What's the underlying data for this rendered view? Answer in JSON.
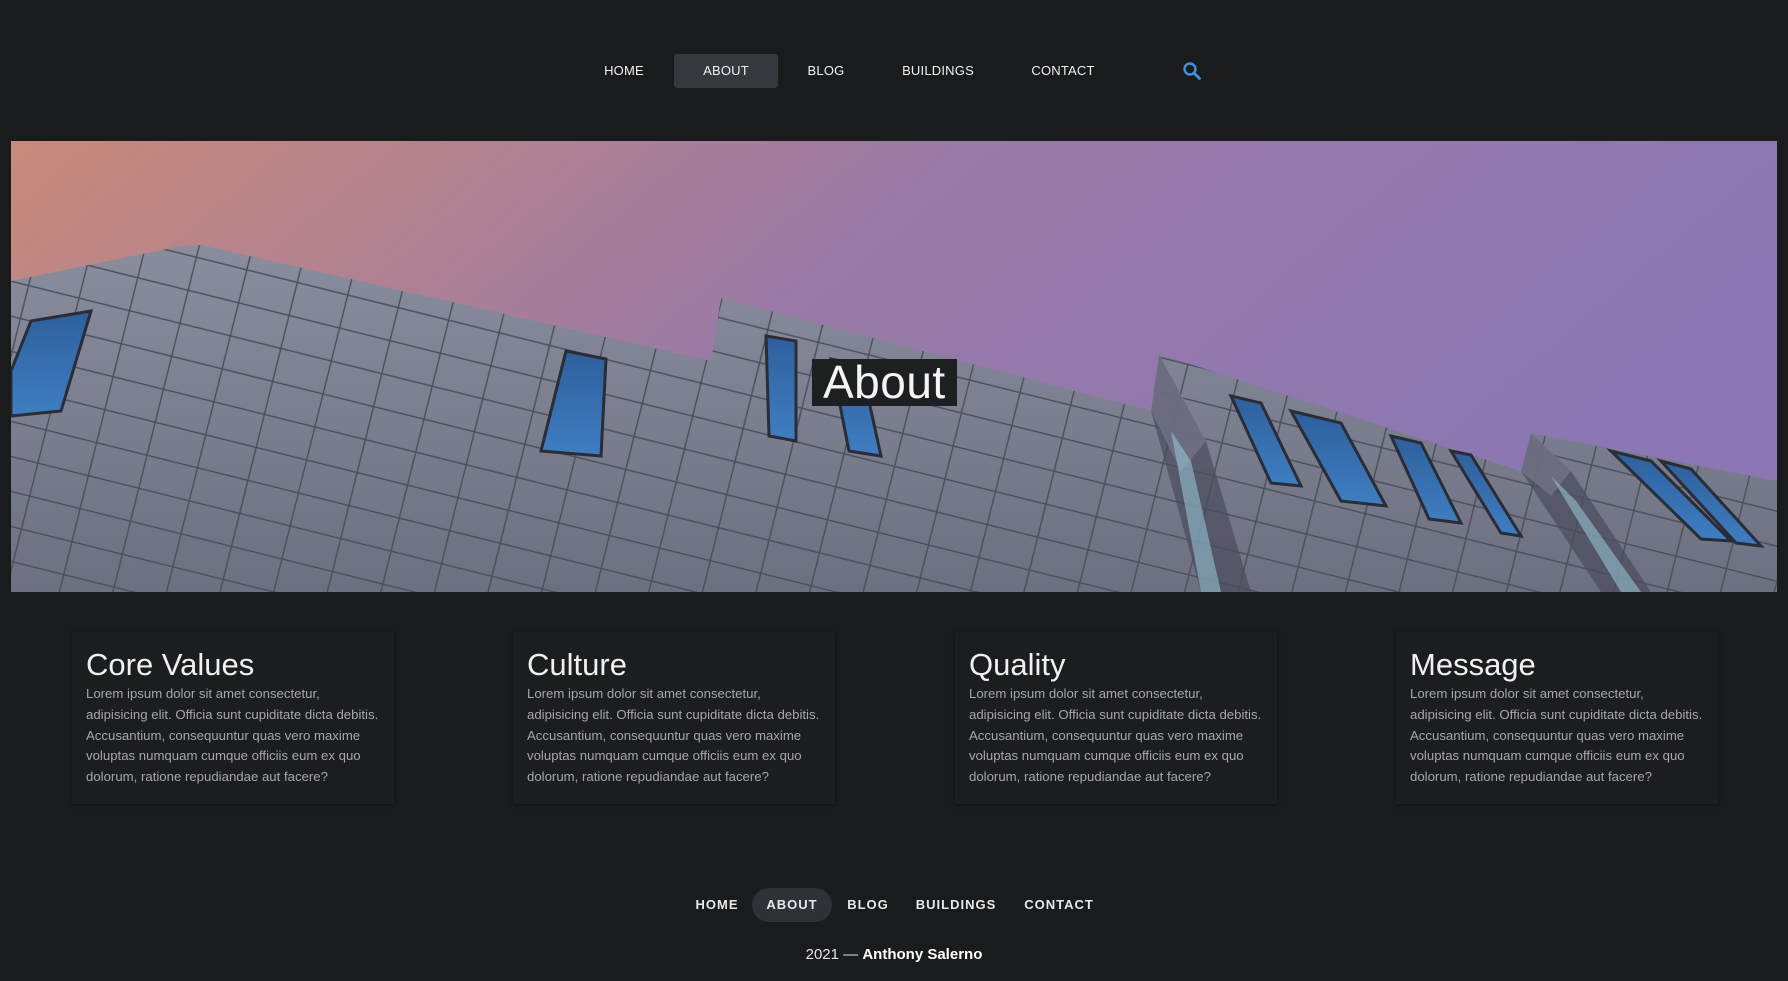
{
  "nav": {
    "items": [
      {
        "label": "HOME",
        "active": false
      },
      {
        "label": "ABOUT",
        "active": true
      },
      {
        "label": "BLOG",
        "active": false
      },
      {
        "label": "BUILDINGS",
        "active": false
      },
      {
        "label": "CONTACT",
        "active": false
      }
    ],
    "search_icon": "search-icon",
    "accent_color": "#3d8fe0"
  },
  "hero": {
    "title": "About",
    "sky_gradient": [
      "#c98a7a",
      "#9a7aa6",
      "#8b77b4"
    ]
  },
  "cards": [
    {
      "title": "Core Values",
      "body": "Lorem ipsum dolor sit amet consectetur, adipisicing elit. Officia sunt cupiditate dicta debitis. Accusantium, consequuntur quas vero maxime voluptas numquam cumque officiis eum ex quo dolorum, ratione repudiandae aut facere?"
    },
    {
      "title": "Culture",
      "body": "Lorem ipsum dolor sit amet consectetur, adipisicing elit. Officia sunt cupiditate dicta debitis. Accusantium, consequuntur quas vero maxime voluptas numquam cumque officiis eum ex quo dolorum, ratione repudiandae aut facere?"
    },
    {
      "title": "Quality",
      "body": "Lorem ipsum dolor sit amet consectetur, adipisicing elit. Officia sunt cupiditate dicta debitis. Accusantium, consequuntur quas vero maxime voluptas numquam cumque officiis eum ex quo dolorum, ratione repudiandae aut facere?"
    },
    {
      "title": "Message",
      "body": "Lorem ipsum dolor sit amet consectetur, adipisicing elit. Officia sunt cupiditate dicta debitis. Accusantium, consequuntur quas vero maxime voluptas numquam cumque officiis eum ex quo dolorum, ratione repudiandae aut facere?"
    }
  ],
  "footer": {
    "nav": [
      {
        "label": "HOME",
        "active": false
      },
      {
        "label": "ABOUT",
        "active": true
      },
      {
        "label": "BLOG",
        "active": false
      },
      {
        "label": "BUILDINGS",
        "active": false
      },
      {
        "label": "CONTACT",
        "active": false
      }
    ],
    "copyright_prefix": "2021 —",
    "author": "Anthony Salerno"
  }
}
